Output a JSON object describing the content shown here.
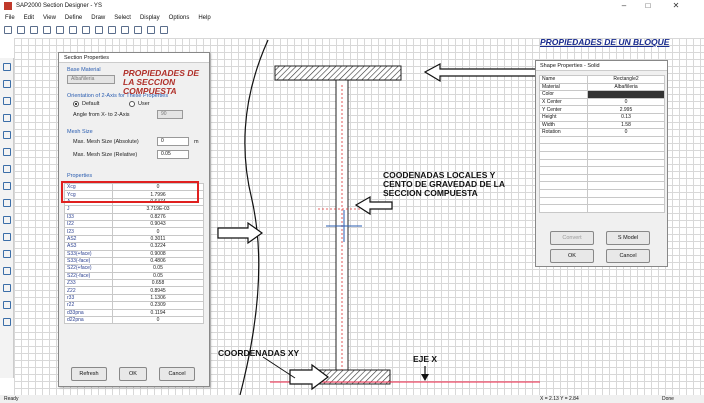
{
  "window": {
    "title": "SAP2000 Section Designer - YS",
    "minimize": "–",
    "maximize": "□",
    "close": "✕"
  },
  "menu": [
    "File",
    "Edit",
    "View",
    "Define",
    "Draw",
    "Select",
    "Display",
    "Options",
    "Help"
  ],
  "toolbar_icons": [
    "new-icon",
    "undo-icon",
    "redo-icon",
    "pencil-icon",
    "zoom-in-icon",
    "zoom-out-icon",
    "zoom-window-icon",
    "zoom-fit-icon",
    "zoom-prev-icon",
    "refresh-icon",
    "grid-icon",
    "pointer-icon",
    "s-icon"
  ],
  "section_dialog": {
    "title": "Section Properties",
    "base_material_label": "Base Material",
    "base_material_value": "Albañileria",
    "orientation_label": "Orientation of 2-Axis for These Properties",
    "radio_default": "Default",
    "radio_user": "User",
    "angle_label": "Angle from X- to 2-Axis",
    "angle_value": "90",
    "mesh_label": "Mesh Size",
    "mesh_abs_label": "Max. Mesh Size (Absolute)",
    "mesh_abs_value": "0",
    "mesh_abs_unit": "m",
    "mesh_rel_label": "Max. Mesh Size (Relative)",
    "mesh_rel_value": "0.05",
    "properties_label": "Properties",
    "properties": [
      {
        "k": "Xcg",
        "v": "0"
      },
      {
        "k": "Ycg",
        "v": "1.7996"
      },
      {
        "k": "A",
        "v": "0.6474"
      },
      {
        "k": "J",
        "v": "3.719E-03"
      },
      {
        "k": "I33",
        "v": "0.8276"
      },
      {
        "k": "I22",
        "v": "0.9043"
      },
      {
        "k": "I23",
        "v": "0"
      },
      {
        "k": "AS2",
        "v": "0.3011"
      },
      {
        "k": "AS3",
        "v": "0.3224"
      },
      {
        "k": "S33(+face)",
        "v": "0.9008"
      },
      {
        "k": "S33(-face)",
        "v": "0.4806"
      },
      {
        "k": "S22(+face)",
        "v": "0.05"
      },
      {
        "k": "S22(-face)",
        "v": "0.05"
      },
      {
        "k": "Z33",
        "v": "0.658"
      },
      {
        "k": "Z22",
        "v": "0.8945"
      },
      {
        "k": "r33",
        "v": "1.1306"
      },
      {
        "k": "r22",
        "v": "0.2309"
      },
      {
        "k": "d33pna",
        "v": "0.1194"
      },
      {
        "k": "d22pna",
        "v": "0"
      }
    ],
    "refresh_button": "Refresh",
    "ok_button": "OK",
    "cancel_button": "Cancel"
  },
  "shape_dialog": {
    "title": "Shape Properties - Solid",
    "rows": [
      {
        "k": "Name",
        "v": "Rectangle2"
      },
      {
        "k": "Material",
        "v": "Albañileria"
      },
      {
        "k": "Color",
        "v": ""
      },
      {
        "k": "X Center",
        "v": "0"
      },
      {
        "k": "Y Center",
        "v": "2.995"
      },
      {
        "k": "Height",
        "v": "0.13"
      },
      {
        "k": "Width",
        "v": "1.58"
      },
      {
        "k": "Rotation",
        "v": "0"
      },
      {
        "k": "",
        "v": ""
      },
      {
        "k": "",
        "v": ""
      },
      {
        "k": "",
        "v": ""
      },
      {
        "k": "",
        "v": ""
      },
      {
        "k": "",
        "v": ""
      },
      {
        "k": "",
        "v": ""
      },
      {
        "k": "",
        "v": ""
      },
      {
        "k": "",
        "v": ""
      },
      {
        "k": "",
        "v": ""
      },
      {
        "k": "",
        "v": ""
      }
    ],
    "convert_button": "Convert",
    "smodel_button": "S Model",
    "ok_button": "OK",
    "cancel_button": "Cancel"
  },
  "annotations": {
    "props_compuesta": "PROPIEDADES DE LA SECCION COMPUESTA",
    "props_bloque": "PROPIEDADES DE UN BLOQUE",
    "coords_locales": "COODENADAS LOCALES Y CENTO DE GRAVEDAD DE LA SECCION COMPUESTA",
    "coords_xy": "COORDENADAS XY",
    "eje_x": "EJE X"
  },
  "status": {
    "left": "Ready",
    "coords": "X = 2.13 Y = 2.84",
    "right": "Done"
  },
  "colors": {
    "annotation_red": "#b0302a",
    "annotation_blue": "#1a2c8f",
    "highlight": "#e0201f",
    "centroid_marker": "#2a5db0"
  }
}
